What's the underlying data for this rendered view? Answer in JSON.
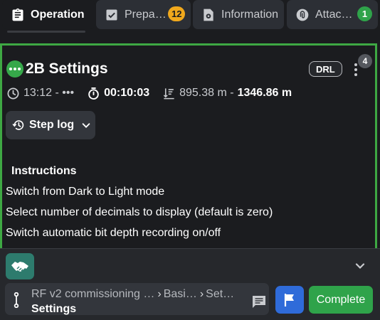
{
  "tabs": [
    {
      "label": "Operation",
      "icon": "clipboard-icon",
      "active": true
    },
    {
      "label": "Prepa…",
      "icon": "checklist-icon",
      "badge": "12",
      "badge_color": "#f0a81c"
    },
    {
      "label": "Information",
      "icon": "gear-file-icon"
    },
    {
      "label": "Attac…",
      "icon": "paperclip-icon",
      "badge": "1",
      "badge_color": "#2fa34a"
    }
  ],
  "step": {
    "status_icon": "in-progress-dots-icon",
    "title": "2B Settings",
    "tag": "DRL",
    "notification_count": "4",
    "start_time": "13:12 - •••",
    "duration": "00:10:03",
    "depth_from": "895.38 m -",
    "depth_to": "1346.86 m",
    "step_log_label": "Step log"
  },
  "instructions": {
    "title": "Instructions",
    "lines": [
      "Switch from Dark to Light mode",
      "Select number of decimals to display (default is zero)",
      "Switch automatic bit depth recording on/off"
    ]
  },
  "footer": {
    "breadcrumb_path": [
      "RF v2 commissioning …",
      "Basi…",
      "Set…"
    ],
    "breadcrumb_current": "Settings",
    "complete_label": "Complete"
  },
  "colors": {
    "accent_green": "#3ea843",
    "complete_green": "#2fa34a",
    "flag_blue": "#2f6bd9",
    "handshake_teal": "#2d7b6d",
    "badge_orange": "#f0a81c",
    "background": "#1b1c1f"
  }
}
